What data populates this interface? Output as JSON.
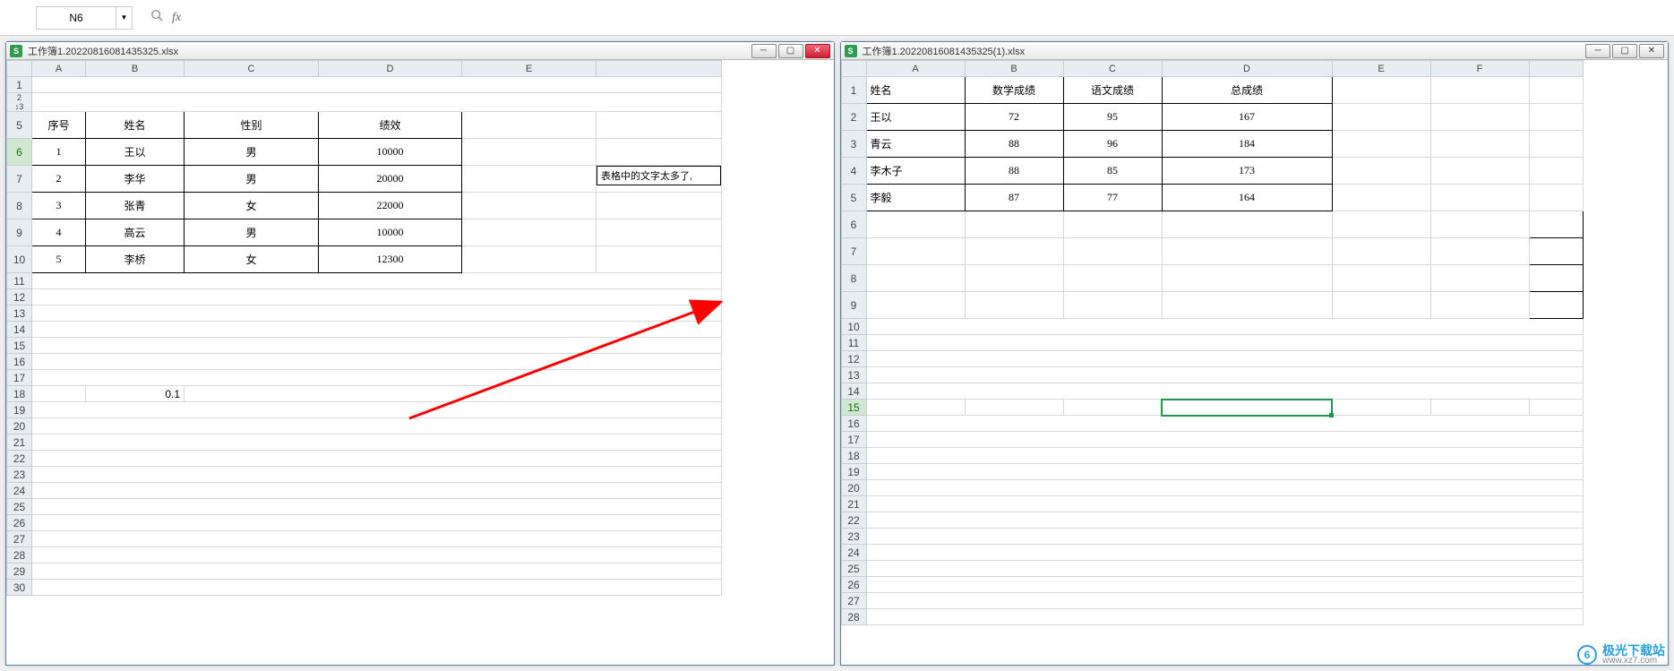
{
  "formula_bar": {
    "name_box": "N6",
    "fx_label": "fx"
  },
  "left": {
    "title": "工作簿1.20220816081435325.xlsx",
    "cols": [
      "A",
      "B",
      "C",
      "D",
      "E"
    ],
    "headers": [
      "序号",
      "姓名",
      "性别",
      "绩效"
    ],
    "rows": [
      [
        "1",
        "王以",
        "男",
        "10000"
      ],
      [
        "2",
        "李华",
        "男",
        "20000"
      ],
      [
        "3",
        "张青",
        "女",
        "22000"
      ],
      [
        "4",
        "高云",
        "男",
        "10000"
      ],
      [
        "5",
        "李桥",
        "女",
        "12300"
      ]
    ],
    "b18_val": "0.1",
    "note": "表格中的文字太多了,",
    "selected_row": "6"
  },
  "right": {
    "title": "工作簿1.20220816081435325(1).xlsx",
    "cols": [
      "A",
      "B",
      "C",
      "D",
      "E",
      "F"
    ],
    "headers": [
      "姓名",
      "数学成绩",
      "语文成绩",
      "总成绩"
    ],
    "rows": [
      [
        "王以",
        "72",
        "95",
        "167"
      ],
      [
        "青云",
        "88",
        "96",
        "184"
      ],
      [
        "李木子",
        "88",
        "85",
        "173"
      ],
      [
        "李毅",
        "87",
        "77",
        "164"
      ]
    ],
    "selected_cell": "D15"
  },
  "watermark": {
    "brand": "极光下载站",
    "url": "www.xz7.com",
    "logo": "6"
  }
}
